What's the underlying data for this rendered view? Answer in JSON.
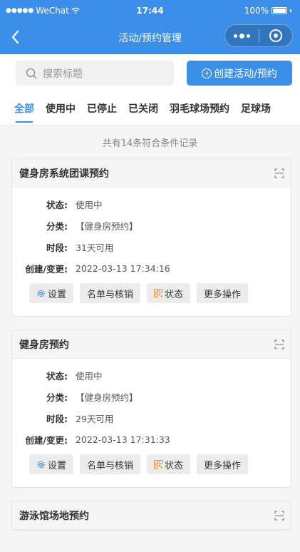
{
  "status_bar": {
    "carrier": "WeChat",
    "time": "17:44",
    "battery": "100%"
  },
  "nav": {
    "title": "活动/预约管理"
  },
  "search": {
    "placeholder": "搜索标题",
    "create_label": "创建活动/预约"
  },
  "tabs": [
    "全部",
    "使用中",
    "已停止",
    "已关闭",
    "羽毛球场预约",
    "足球场"
  ],
  "count_text": "共有14条符合条件记录",
  "labels": {
    "status": "状态:",
    "category": "分类:",
    "period": "时段:",
    "created": "创建/变更:"
  },
  "buttons": {
    "settings": "设置",
    "roster": "名单与核销",
    "status": "状态",
    "more": "更多操作"
  },
  "cards": [
    {
      "title": "健身房系统团课预约",
      "status": "使用中",
      "category": "【健身房预约】",
      "period": "31天可用",
      "created": "2022-03-13 17:34:16"
    },
    {
      "title": "健身房预约",
      "status": "使用中",
      "category": "【健身房预约】",
      "period": "29天可用",
      "created": "2022-03-13 17:31:33"
    },
    {
      "title": "游泳馆场地预约"
    }
  ],
  "colors": {
    "primary": "#3b8fe8",
    "gear": "#3b8fe8",
    "qr": "#f08a24"
  }
}
